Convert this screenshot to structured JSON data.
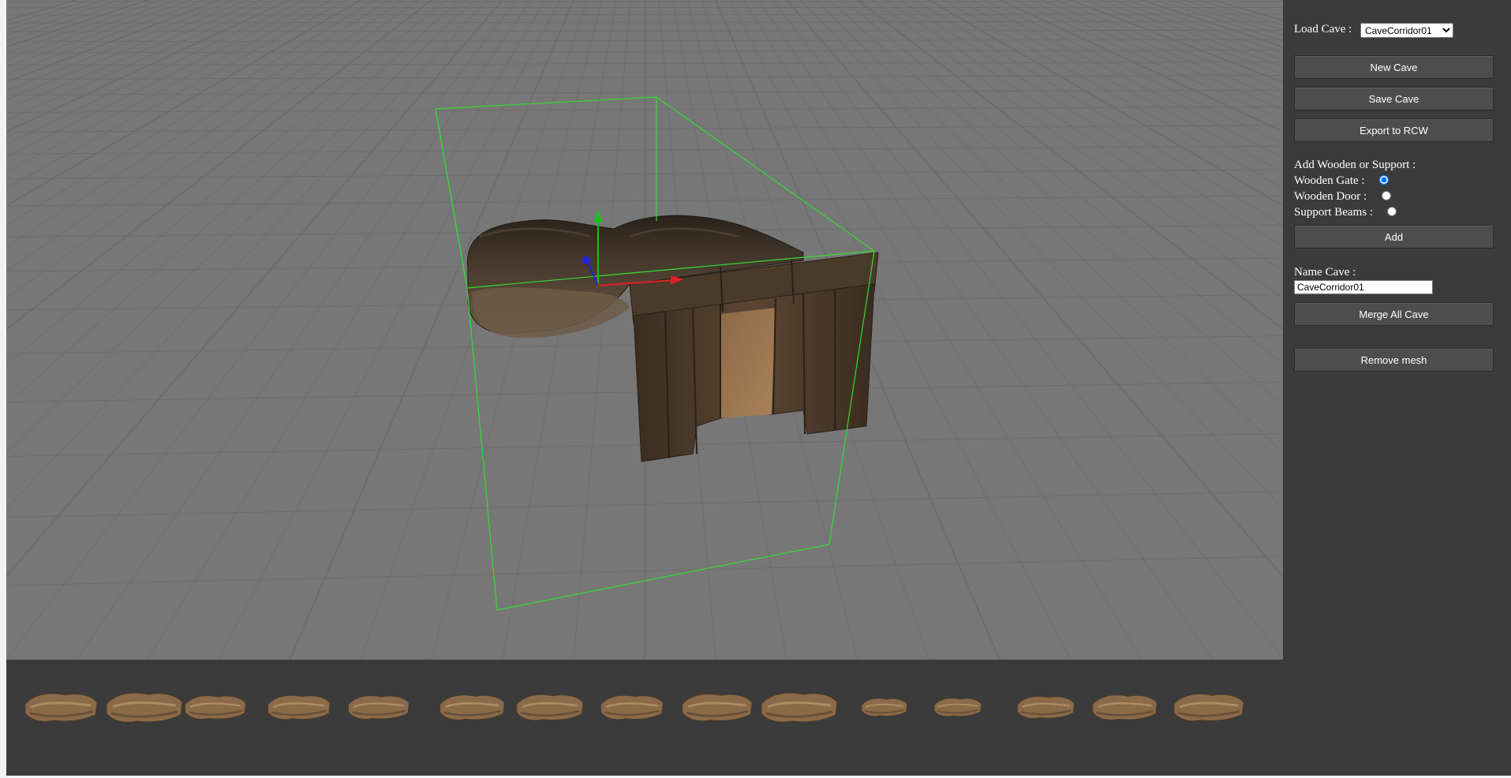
{
  "viewport": {
    "background": "#777777",
    "grid_color": "#6a6a6a",
    "bbox_color": "#33dd33",
    "axis_colors": {
      "x": "#dd2222",
      "y": "#22bb22",
      "z": "#2222dd"
    }
  },
  "sidebar": {
    "load_cave_label": "Load Cave :",
    "load_cave_selected": "CaveCorridor01",
    "new_cave": "New Cave",
    "save_cave": "Save Cave",
    "export": "Export to RCW",
    "add_section_label": "Add Wooden or Support :",
    "options": {
      "gate": "Wooden Gate :",
      "door": "Wooden Door :",
      "beams": "Support Beams :"
    },
    "selected_option": "gate",
    "add": "Add",
    "name_cave_label": "Name Cave :",
    "name_cave_value": "CaveCorridor01",
    "merge": "Merge All Cave",
    "remove": "Remove mesh"
  },
  "bottombar": {
    "thumbnail_count": 15,
    "thumbnail_icon": "cave-piece-icon"
  }
}
